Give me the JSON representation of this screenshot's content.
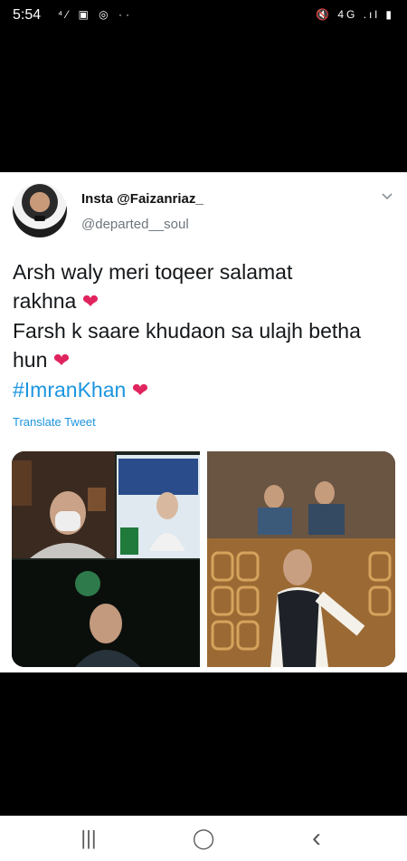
{
  "status_bar": {
    "time": "5:54",
    "left_icons": [
      "wifi-call-icon",
      "gallery-icon",
      "instagram-icon",
      "more-dots-icon"
    ],
    "left_glyphs": "⁴⁄ ▣ ◎ ··",
    "right_glyphs": "🔇 4G .ıl ▮"
  },
  "tweet": {
    "display_name": "Insta @Faizanriaz_",
    "handle": "@departed__soul",
    "lines": [
      "Arsh waly meri toqeer salamat",
      "rakhna",
      "Farsh k saare khudaon sa ulajh betha",
      "hun",
      "#ImranKhan"
    ],
    "heart": "❤",
    "translate_label": "Translate Tweet"
  },
  "nav": {
    "recent": "|||",
    "home": "◯",
    "back": "‹"
  },
  "colors": {
    "link": "#1b95e0",
    "heart": "#e0245e"
  }
}
